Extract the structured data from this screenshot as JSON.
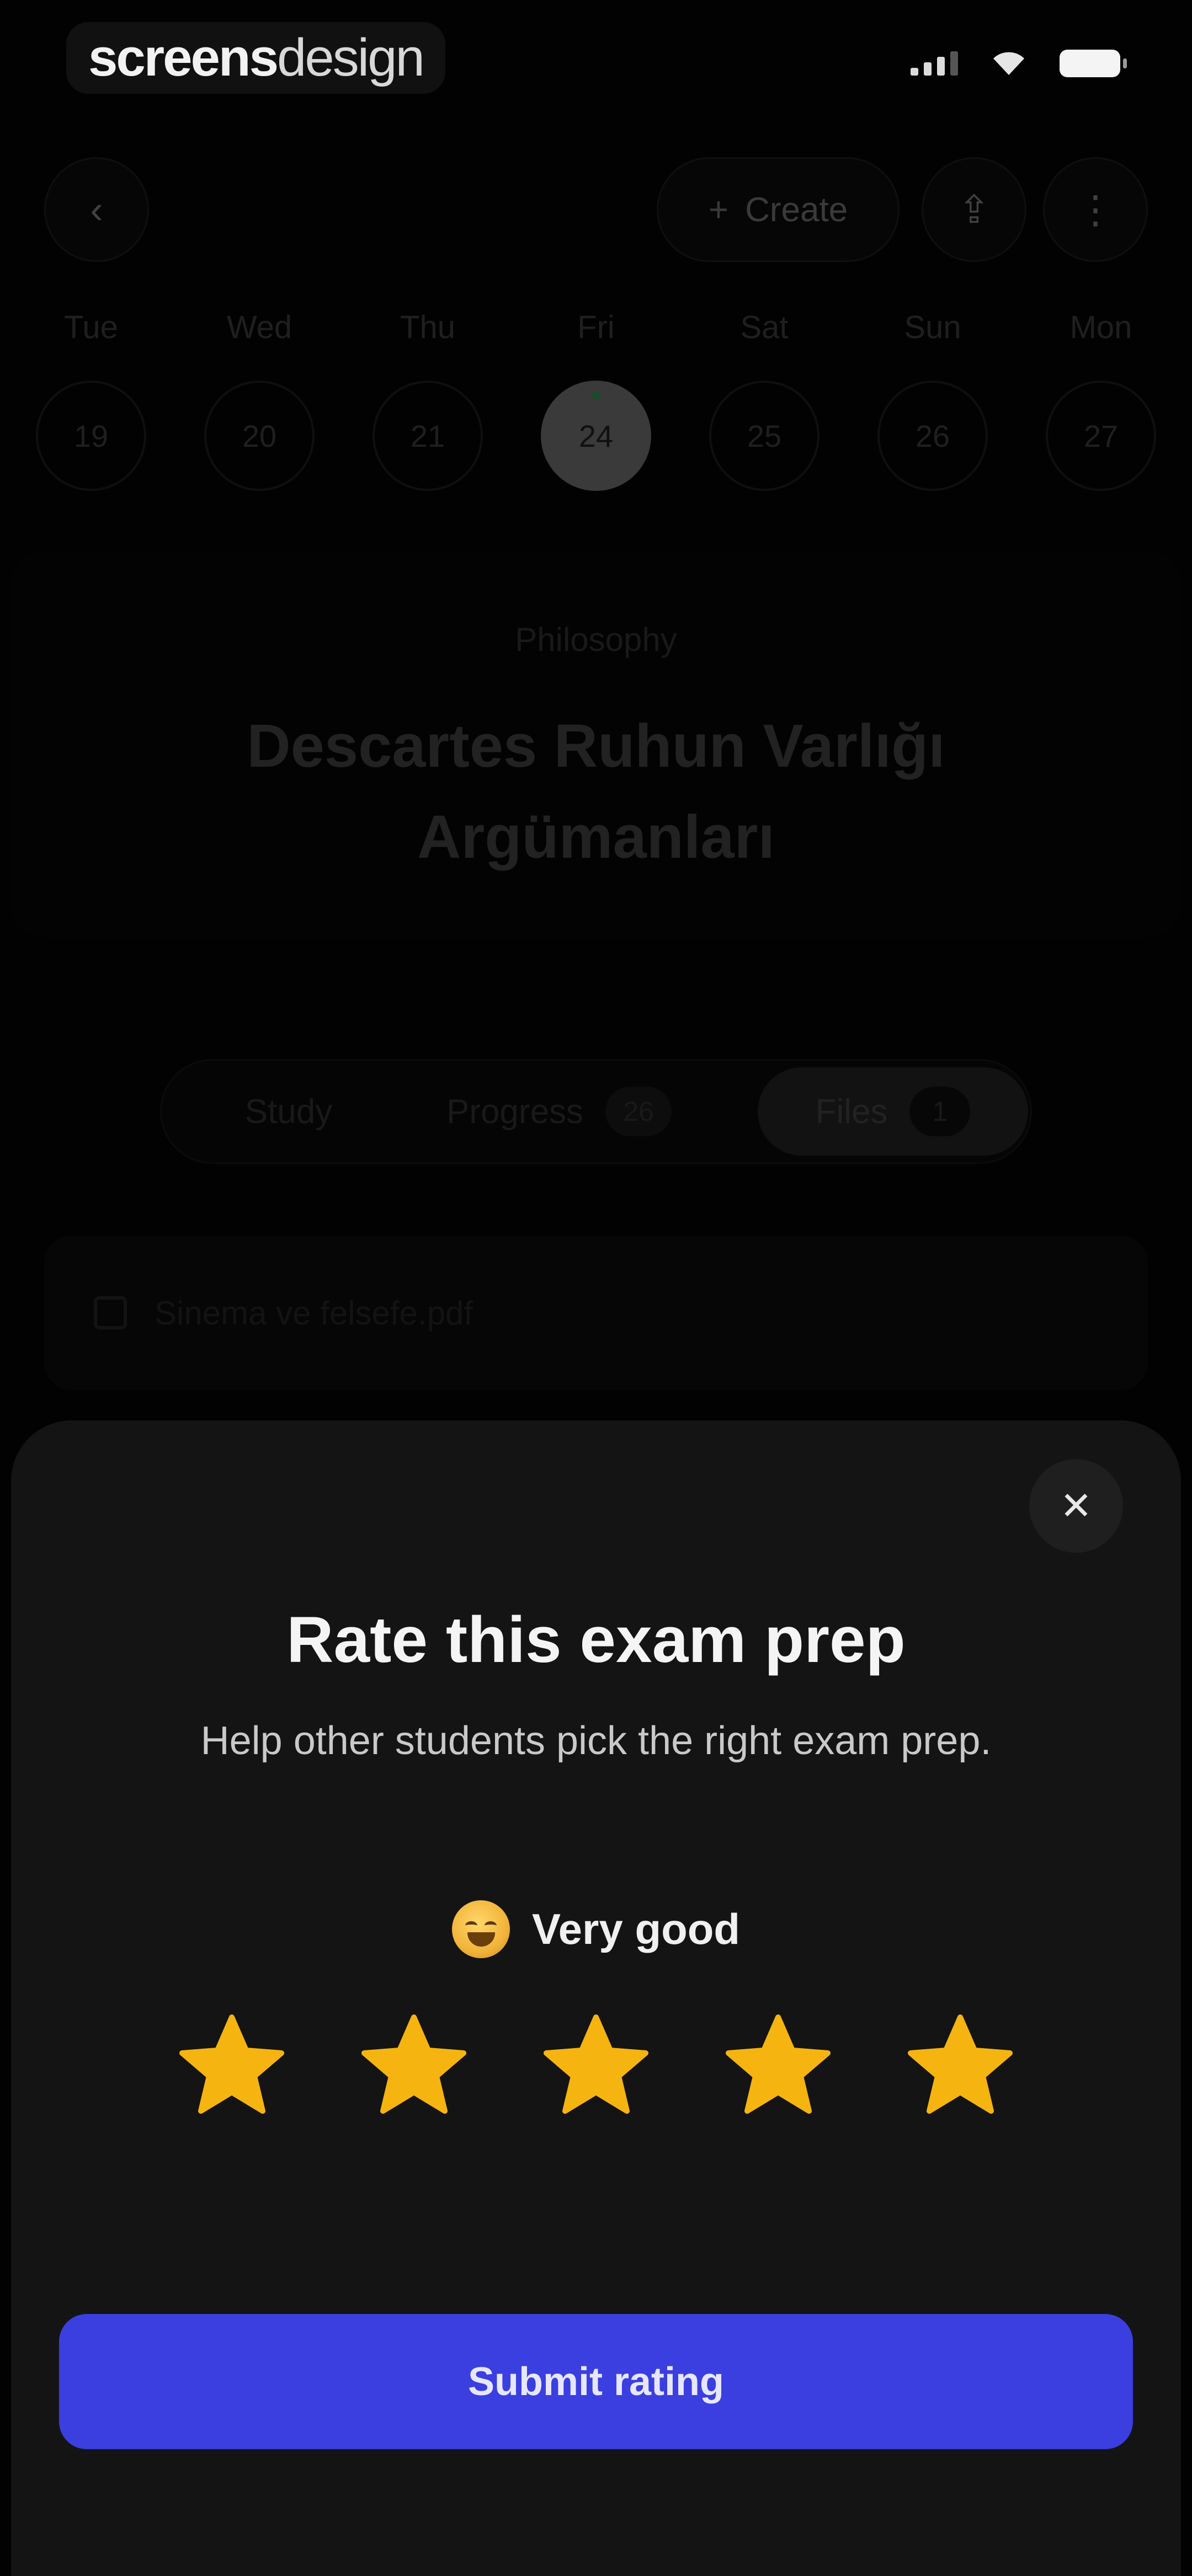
{
  "status_bar": {
    "watermark_bold": "screens",
    "watermark_light": "design"
  },
  "header": {
    "back_icon": "chevron-left-icon",
    "create_label": "Create",
    "share_icon": "share-icon",
    "more_icon": "more-vertical-icon"
  },
  "calendar": {
    "days": [
      {
        "name": "Tue",
        "num": "19"
      },
      {
        "name": "Wed",
        "num": "20"
      },
      {
        "name": "Thu",
        "num": "21"
      },
      {
        "name": "Fri",
        "num": "24",
        "active": true
      },
      {
        "name": "Sat",
        "num": "25"
      },
      {
        "name": "Sun",
        "num": "26"
      },
      {
        "name": "Mon",
        "num": "27"
      }
    ]
  },
  "lesson": {
    "subject": "Philosophy",
    "title": "Descartes Ruhun Varlığı Argümanları"
  },
  "tabs": {
    "study": "Study",
    "progress": "Progress",
    "progress_count": "26",
    "files": "Files",
    "files_count": "1"
  },
  "file": {
    "name": "Sinema ve felsefe.pdf"
  },
  "rating_sheet": {
    "title": "Rate this exam prep",
    "subtitle": "Help other students pick the right exam prep.",
    "rating_label": "Very good",
    "rating_value": 5,
    "rating_max": 5,
    "star_color": "#f5b40f",
    "submit_label": "Submit rating",
    "submit_color": "#3b3fe0"
  }
}
